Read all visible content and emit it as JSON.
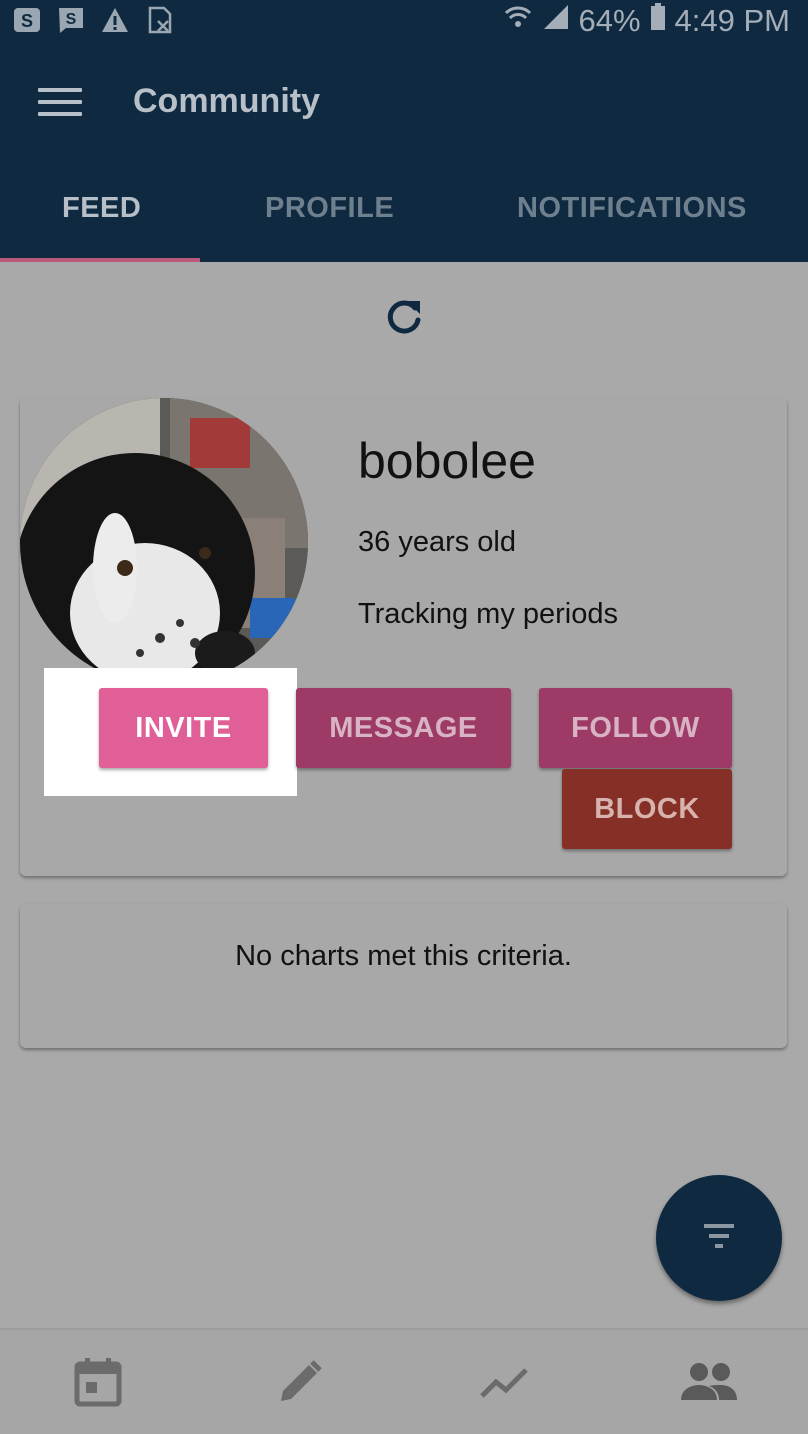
{
  "status_bar": {
    "icons": [
      "s-badge-icon",
      "s-message-icon",
      "warning-icon",
      "no-sim-icon",
      "wifi-icon",
      "signal-icon",
      "battery-icon"
    ],
    "battery": "64%",
    "time": "4:49 PM"
  },
  "app_bar": {
    "title": "Community",
    "menu_icon": "hamburger-menu-icon"
  },
  "tabs": [
    {
      "label": "FEED",
      "active": true
    },
    {
      "label": "PROFILE",
      "active": false
    },
    {
      "label": "NOTIFICATIONS",
      "active": false
    }
  ],
  "refresh_icon": "refresh-icon",
  "profile": {
    "username": "bobolee",
    "age": "36 years old",
    "bio": "Tracking my periods",
    "avatar_icon": "dog-avatar-photo"
  },
  "buttons": {
    "invite": "INVITE",
    "message": "MESSAGE",
    "follow": "FOLLOW",
    "block": "BLOCK"
  },
  "empty_state": {
    "text": "No charts met this criteria."
  },
  "fab": {
    "icon": "filter-icon"
  },
  "bottom_nav": [
    {
      "icon": "calendar-icon"
    },
    {
      "icon": "pencil-icon"
    },
    {
      "icon": "trend-chart-icon"
    },
    {
      "icon": "community-people-icon"
    }
  ],
  "colors": {
    "primary": "#0f2a40",
    "accent_pink": "#e05f97",
    "button_muted": "#9d3a65",
    "block_red": "#862f26",
    "tab_indicator": "#b9587b"
  }
}
